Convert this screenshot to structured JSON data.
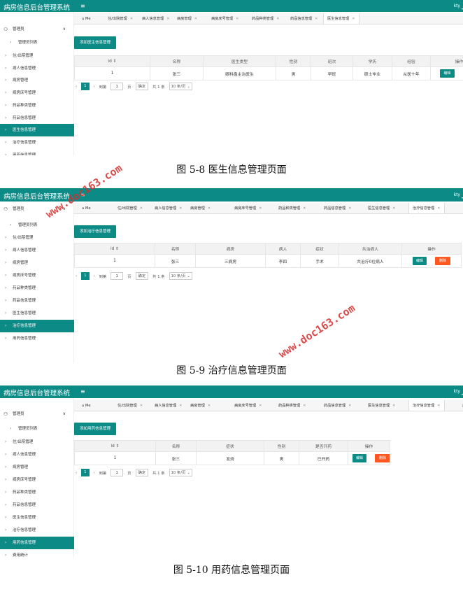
{
  "app_title": "病房信息后台管理系统",
  "user": "kty",
  "watermark": "www.doc163.com",
  "accent_color": "#0b8a86",
  "delete_color": "#ff5722",
  "edit_label": "编辑",
  "delete_label": "删除",
  "pager": {
    "page": "1",
    "goto": "到第",
    "page_unit": "页",
    "confirm": "确定",
    "total": "共 1 条",
    "per_page": "10 条/页"
  },
  "screens": [
    {
      "sidebar": [
        {
          "label": "管理员",
          "type": "group"
        },
        {
          "label": "管理员列表",
          "type": "sub"
        },
        {
          "label": "住/出院管理",
          "type": "item"
        },
        {
          "label": "病人信息管理",
          "type": "item"
        },
        {
          "label": "病房管理",
          "type": "item"
        },
        {
          "label": "病房床号管理",
          "type": "item"
        },
        {
          "label": "药品种类管理",
          "type": "item"
        },
        {
          "label": "药品信息管理",
          "type": "item"
        },
        {
          "label": "医生信息管理",
          "type": "item",
          "active": true
        },
        {
          "label": "治疗信息管理",
          "type": "item"
        },
        {
          "label": "用药信息管理",
          "type": "item"
        }
      ],
      "tabs": [
        "Me",
        "住/出院管理",
        "病人信息管理",
        "病房管理",
        "病房床号管理",
        "药品种类管理",
        "药品信息管理",
        "医生信息管理"
      ],
      "add_label": "添加医生信息管理",
      "columns": [
        "id ⇕",
        "名称",
        "医生类型",
        "性别",
        "班次",
        "学历",
        "经验",
        "操作"
      ],
      "row": [
        "1",
        "张三",
        "眼科盘主治医生",
        "男",
        "早班",
        "硕士毕业",
        "从医十年"
      ],
      "caption": "图 5-8 医生信息管理页面"
    },
    {
      "sidebar": [
        {
          "label": "管理员",
          "type": "group"
        },
        {
          "label": "管理员列表",
          "type": "sub"
        },
        {
          "label": "住/出院管理",
          "type": "item"
        },
        {
          "label": "病人信息管理",
          "type": "item"
        },
        {
          "label": "病房管理",
          "type": "item"
        },
        {
          "label": "病房床号管理",
          "type": "item"
        },
        {
          "label": "药品种类管理",
          "type": "item"
        },
        {
          "label": "药品信息管理",
          "type": "item"
        },
        {
          "label": "医生信息管理",
          "type": "item"
        },
        {
          "label": "治疗信息管理",
          "type": "item",
          "active": true
        },
        {
          "label": "用药信息管理",
          "type": "item"
        }
      ],
      "tabs": [
        "Me",
        "住/出院管理",
        "病人信息管理",
        "病房管理",
        "病房床号管理",
        "药品种类管理",
        "药品信息管理",
        "医生信息管理",
        "治疗信息管理"
      ],
      "add_label": "添加治疗信息管理",
      "columns": [
        "id ⇕",
        "名称",
        "病房",
        "病人",
        "症状",
        "共治病人",
        "操作"
      ],
      "row": [
        "1",
        "张三",
        "三病房",
        "李四",
        "手术",
        "共治疗0位病人"
      ],
      "caption": "图 5-9 治疗信息管理页面"
    },
    {
      "sidebar": [
        {
          "label": "管理员",
          "type": "group"
        },
        {
          "label": "管理员列表",
          "type": "sub"
        },
        {
          "label": "住/出院管理",
          "type": "item"
        },
        {
          "label": "病人信息管理",
          "type": "item"
        },
        {
          "label": "病房管理",
          "type": "item"
        },
        {
          "label": "病房床号管理",
          "type": "item"
        },
        {
          "label": "药品种类管理",
          "type": "item"
        },
        {
          "label": "药品信息管理",
          "type": "item"
        },
        {
          "label": "医生信息管理",
          "type": "item"
        },
        {
          "label": "治疗信息管理",
          "type": "item"
        },
        {
          "label": "用药信息管理",
          "type": "item",
          "active": true
        },
        {
          "label": "费用统计",
          "type": "item"
        }
      ],
      "tabs": [
        "Me",
        "住/出院管理",
        "病人信息管理",
        "病房管理",
        "病房床号管理",
        "药品种类管理",
        "药品信息管理",
        "医生信息管理",
        "治疗信息管理",
        "用"
      ],
      "add_label": "添加用药信息管理",
      "columns": [
        "id ⇕",
        "名称",
        "症状",
        "性别",
        "是否开药",
        "操作"
      ],
      "row": [
        "1",
        "张三",
        "发烧",
        "男",
        "已开药"
      ],
      "caption": "图 5-10 用药信息管理页面"
    }
  ]
}
